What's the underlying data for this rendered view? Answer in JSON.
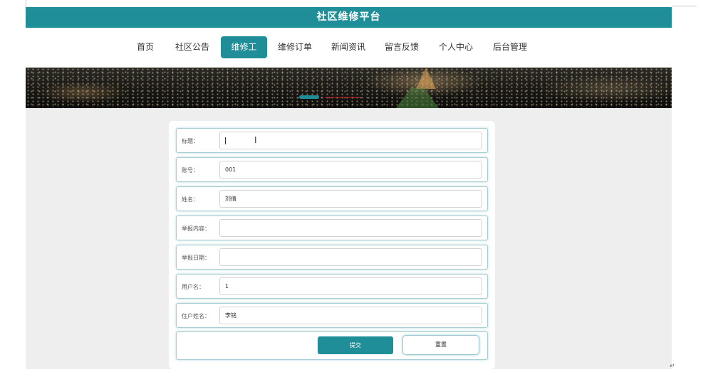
{
  "header": {
    "title": "社区维修平台"
  },
  "nav": {
    "items": [
      {
        "label": "首页",
        "active": false
      },
      {
        "label": "社区公告",
        "active": false
      },
      {
        "label": "维修工",
        "active": true
      },
      {
        "label": "维修订单",
        "active": false
      },
      {
        "label": "新闻资讯",
        "active": false
      },
      {
        "label": "留言反馈",
        "active": false
      },
      {
        "label": "个人中心",
        "active": false
      },
      {
        "label": "后台管理",
        "active": false
      }
    ]
  },
  "banner": {
    "icon": "city-night-image",
    "slides": 2,
    "active_slide": 1
  },
  "form": {
    "fields": [
      {
        "label": "标题：",
        "value": ""
      },
      {
        "label": "账号：",
        "value": "001"
      },
      {
        "label": "姓名：",
        "value": "刘倩"
      },
      {
        "label": "举报内容：",
        "value": ""
      },
      {
        "label": "举报日期：",
        "value": ""
      },
      {
        "label": "用户名：",
        "value": "1"
      },
      {
        "label": "住户姓名：",
        "value": "李铭"
      }
    ],
    "submit_label": "提交",
    "reset_label": "重置"
  },
  "colors": {
    "accent": "#1f8e98",
    "background": "#eeeeee"
  }
}
